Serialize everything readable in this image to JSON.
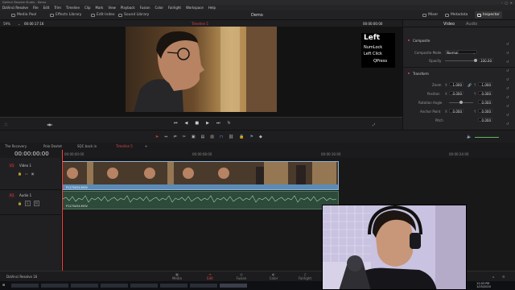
{
  "window": {
    "title": "DaVinci Resolve Studio - Demo"
  },
  "menu": [
    "DaVinci Resolve",
    "File",
    "Edit",
    "Trim",
    "Timeline",
    "Clip",
    "Mark",
    "View",
    "Playback",
    "Fusion",
    "Color",
    "Fairlight",
    "Workspace",
    "Help"
  ],
  "toolbar": {
    "media_pool": "Media Pool",
    "effects_library": "Effects Library",
    "edit_index": "Edit Index",
    "sound_library": "Sound Library",
    "project_name": "Demo",
    "mixer": "Mixer",
    "metadata": "Metadata",
    "inspector": "Inspector"
  },
  "viewer": {
    "zoom": "59%",
    "timecode_left": "00:00:17:16",
    "timeline_name": "Timeline 5",
    "timecode_right": "00:00:00:00"
  },
  "overlay": {
    "big": "Left",
    "lines": [
      "NumLock",
      "Left Click",
      "QPress"
    ]
  },
  "inspector": {
    "tabs": [
      "Video",
      "Audio"
    ],
    "composite": {
      "title": "Composite",
      "mode_label": "Composite Mode",
      "mode_value": "Normal",
      "opacity_label": "Opacity",
      "opacity_value": "100.00"
    },
    "transform": {
      "title": "Transform",
      "rows": [
        {
          "label": "Zoom",
          "a": "X",
          "av": "1.000",
          "b": "Y",
          "bv": "1.000"
        },
        {
          "label": "Position",
          "a": "X",
          "av": "0.000",
          "b": "Y",
          "bv": "0.000"
        },
        {
          "label": "Rotation Angle",
          "a": "",
          "av": "",
          "b": "",
          "bv": "0.000"
        },
        {
          "label": "Anchor Point",
          "a": "X",
          "av": "0.000",
          "b": "Y",
          "bv": "0.000"
        },
        {
          "label": "Pitch",
          "a": "",
          "av": "",
          "b": "",
          "bv": "0.000"
        }
      ]
    }
  },
  "timeline_tabs": [
    "The Recovery",
    "Polo Dextet",
    "SQC back in",
    "Timeline 5"
  ],
  "timeline": {
    "timecode": "00:00:00:00",
    "ruler": [
      "00:00:00:00",
      "00:00:08:00",
      "00:00:16:00",
      "00:00:24:00"
    ],
    "tracks": [
      {
        "id": "V1",
        "name": "Video 1",
        "clip": "P1270434.MOV"
      },
      {
        "id": "A1",
        "name": "Audio 1",
        "clip": "P1270434.MOV"
      }
    ]
  },
  "app_brand": "DaVinci Resolve 16",
  "pages": [
    "Media",
    "Edit",
    "Fusion",
    "Color",
    "Fairlight"
  ],
  "active_page": "Edit",
  "colors": {
    "accent_red": "#e0474c",
    "clip_blue": "#5b8bb7",
    "playhead": "#ff3b3b"
  },
  "taskbar": {
    "time": "12:03 PM",
    "date": "1/25/2020"
  }
}
